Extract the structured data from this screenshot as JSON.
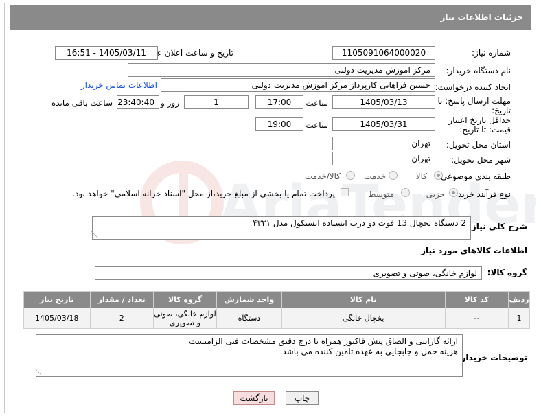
{
  "header": {
    "title": "جزئیات اطلاعات نیاز"
  },
  "labels": {
    "need_number": "شماره نیاز:",
    "announce_datetime": "تاریخ و ساعت اعلان عمومی:",
    "buyer_org": "نام دستگاه خریدار:",
    "requester": "ایجاد کننده درخواست:",
    "reply_deadline": "مهلت ارسال پاسخ: تا تاریخ:",
    "time": "ساعت",
    "day_and": "روز و",
    "remaining": "ساعت باقی مانده",
    "price_validity": "حداقل تاریخ اعتبار قیمت: تا تاریخ:",
    "province": "استان محل تحویل:",
    "city": "شهر محل تحویل:",
    "category": "طبقه بندی موضوعی:",
    "process_type": "نوع فرآیند خرید :",
    "description": "شرح کلی نیاز:",
    "goods_info": "اطلاعات کالاهای مورد نیاز",
    "goods_group": "گروه کالا:",
    "buyer_notes": "توضیحات خریدار:"
  },
  "values": {
    "need_number": "1105091064000020",
    "announce_datetime": "1405/03/11 - 16:51",
    "buyer_org": "مرکز اموزش مدیریت دولتی",
    "requester": "حسین  فراهانی کارپرداز مرکز اموزش مدیریت دولتی",
    "contact_link": "اطلاعات تماس خریدار",
    "reply_date": "1405/03/13",
    "reply_time": "17:00",
    "reply_days": "1",
    "remaining_time": "23:40:40",
    "validity_date": "1405/03/31",
    "validity_time": "19:00",
    "province": "تهران",
    "city": "تهران",
    "description": "2 دستگاه یخچال 13 فوت دو درب ایستاده ایستکول مدل ۴۳۲۱",
    "goods_group": "لوازم خانگی، صوتی و تصویری",
    "buyer_notes_line1": "ارائه گارانتی و الصاق پیش فاکتور همراه با درج دقیق مشخصات فنی الزامیست",
    "buyer_notes_line2": "هزینه حمل و جابجایی به عهده تأمین کننده می باشد."
  },
  "category_options": {
    "goods": "کالا",
    "service": "خدمت",
    "goods_service": "کالا/خدمت",
    "selected": "کالا"
  },
  "process_options": {
    "partial": "جزیی",
    "medium": "متوسط",
    "selected": "جزیی"
  },
  "payment_note": "پرداخت تمام یا بخشی از مبلغ خرید،از محل \"اسناد خزانه اسلامی\" خواهد بود.",
  "table": {
    "headers": [
      "ردیف",
      "کد کالا",
      "نام کالا",
      "واحد شمارش",
      "گروه کالا",
      "تعداد / مقدار",
      "تاریخ نیاز"
    ],
    "rows": [
      {
        "row": "1",
        "code": "--",
        "name": "یخچال خانگی",
        "unit": "دستگاه",
        "group": "لوازم خانگی، صوتی و تصویری",
        "qty": "2",
        "date": "1405/03/18"
      }
    ]
  },
  "buttons": {
    "print": "چاپ",
    "back": "بازگشت"
  },
  "watermark": "AriaTender.net"
}
